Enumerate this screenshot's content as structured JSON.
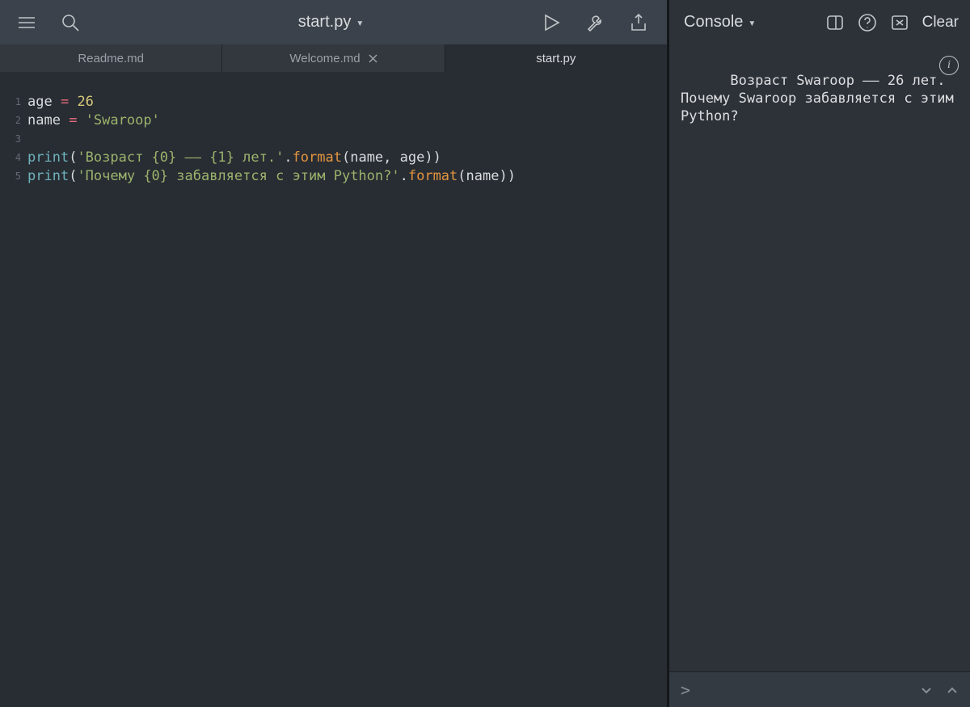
{
  "header": {
    "title": "start.py"
  },
  "tabs": [
    {
      "label": "Readme.md",
      "closeable": false,
      "active": false
    },
    {
      "label": "Welcome.md",
      "closeable": true,
      "active": false
    },
    {
      "label": "start.py",
      "closeable": false,
      "active": true
    }
  ],
  "editor": {
    "line_numbers": [
      "1",
      "2",
      "3",
      "4",
      "5"
    ],
    "lines": [
      [
        {
          "t": "age ",
          "c": "tok-var"
        },
        {
          "t": "= ",
          "c": "tok-op"
        },
        {
          "t": "26",
          "c": "tok-num"
        }
      ],
      [
        {
          "t": "name ",
          "c": "tok-var"
        },
        {
          "t": "= ",
          "c": "tok-op"
        },
        {
          "t": "'Swaroop'",
          "c": "tok-str"
        }
      ],
      [
        {
          "t": "",
          "c": "tok-plain"
        }
      ],
      [
        {
          "t": "print",
          "c": "tok-builtin"
        },
        {
          "t": "(",
          "c": "tok-plain"
        },
        {
          "t": "'Возраст {0} –– {1} лет.'",
          "c": "tok-str"
        },
        {
          "t": ".",
          "c": "tok-plain"
        },
        {
          "t": "format",
          "c": "tok-fn"
        },
        {
          "t": "(name, age))",
          "c": "tok-plain"
        }
      ],
      [
        {
          "t": "print",
          "c": "tok-builtin"
        },
        {
          "t": "(",
          "c": "tok-plain"
        },
        {
          "t": "'Почему {0} забавляется с этим Python?'",
          "c": "tok-str"
        },
        {
          "t": ".",
          "c": "tok-plain"
        },
        {
          "t": "format",
          "c": "tok-fn"
        },
        {
          "t": "(name))",
          "c": "tok-plain"
        }
      ]
    ]
  },
  "console": {
    "title": "Console",
    "clear_label": "Clear",
    "output": "Возраст Swaroop –– 26 лет.\nПочему Swaroop забавляется с этим Python?",
    "prompt": ">",
    "input_value": ""
  }
}
